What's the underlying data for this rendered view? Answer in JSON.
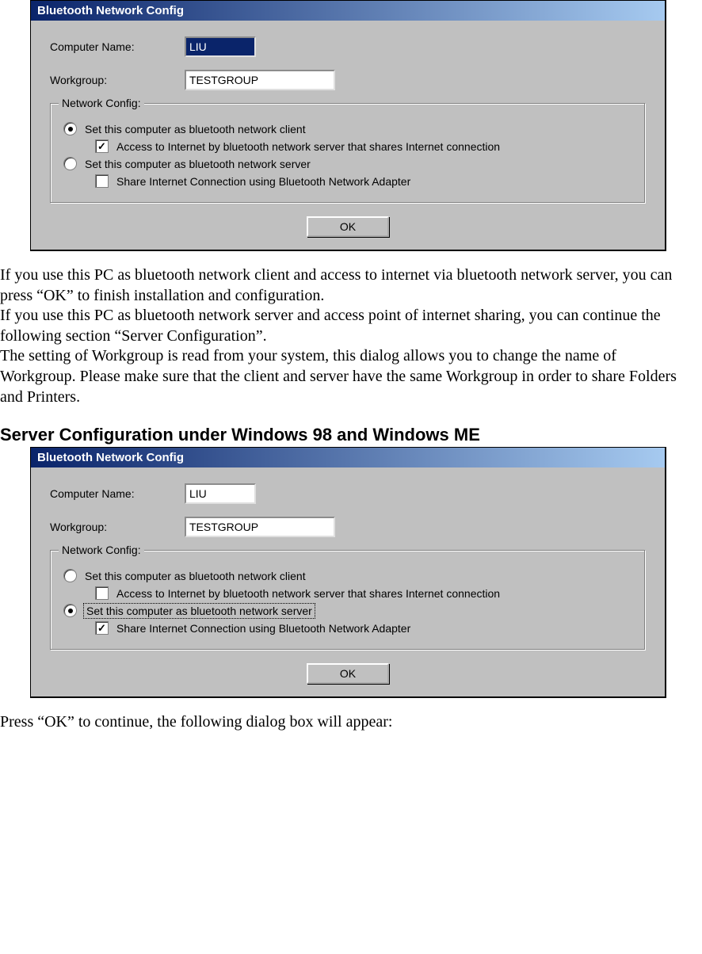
{
  "dialog1": {
    "title": "Bluetooth Network Config",
    "computer_name_label": "Computer Name:",
    "computer_name_value": "LIU",
    "workgroup_label": "Workgroup:",
    "workgroup_value": "TESTGROUP",
    "group_legend": "Network Config:",
    "radio_client_label": "Set this computer as bluetooth network client",
    "check_access_label": "Access to Internet by bluetooth network server that shares Internet connection",
    "radio_server_label": "Set this computer as bluetooth network server",
    "check_share_label": "Share Internet Connection using Bluetooth Network Adapter",
    "ok_label": "OK"
  },
  "para1": "If you use this PC as bluetooth network client and access to internet via bluetooth network server, you can press “OK” to finish installation and configuration.",
  "para2": "If you use this PC as bluetooth network server and access point of internet sharing, you can continue the following section “Server Configuration”.",
  "para3": "The setting of Workgroup is read from your system, this dialog allows you to change the name of Workgroup. Please make sure that the client and server have the same Workgroup in order to share Folders and Printers.",
  "heading": "Server Configuration under Windows 98 and Windows ME",
  "dialog2": {
    "title": "Bluetooth Network Config",
    "computer_name_label": "Computer Name:",
    "computer_name_value": "LIU",
    "workgroup_label": "Workgroup:",
    "workgroup_value": "TESTGROUP",
    "group_legend": "Network Config:",
    "radio_client_label": "Set this computer as bluetooth network client",
    "check_access_label": "Access to Internet by bluetooth network server that shares Internet connection",
    "radio_server_label": "Set this computer as bluetooth network server",
    "check_share_label": "Share Internet Connection using Bluetooth Network Adapter",
    "ok_label": "OK"
  },
  "para4": "Press “OK” to continue, the following dialog box will appear:"
}
